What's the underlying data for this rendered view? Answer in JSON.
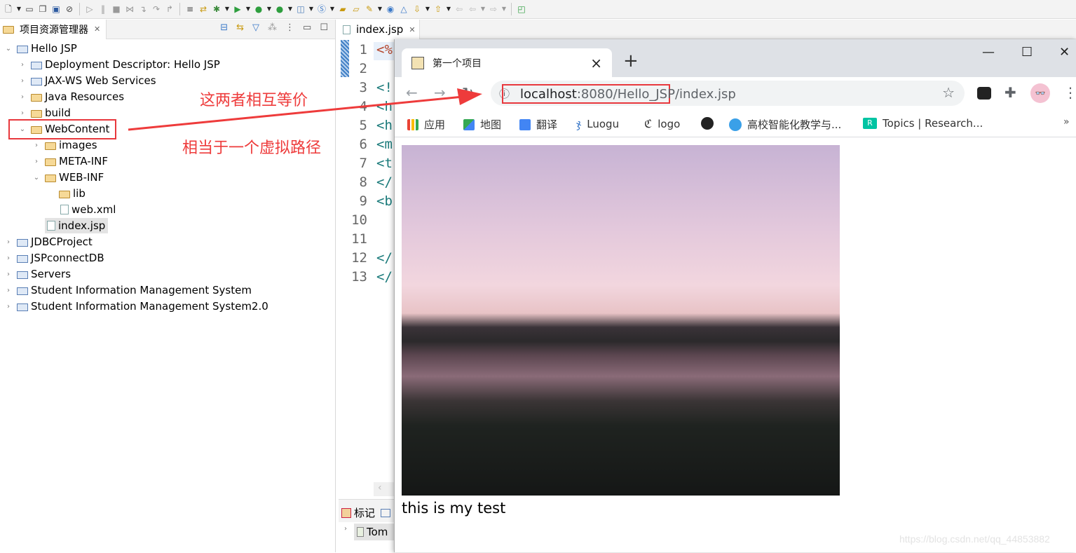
{
  "toolbar": {
    "icons": [
      "new-icon",
      "save-icon",
      "save-all-icon",
      "console-icon",
      "skip-breakpoints-icon",
      "resume-icon",
      "suspend-icon",
      "terminate-icon",
      "disconnect-icon",
      "step-into-icon",
      "step-over-icon",
      "step-return-icon",
      "drop-to-frame-icon",
      "use-step-filters-icon",
      "debug-icon",
      "run-icon",
      "run-config-icon",
      "external-tools-icon",
      "new-server-icon",
      "new-spring-icon",
      "open-type-icon",
      "open-folder-icon",
      "search-icon",
      "web-browser-icon",
      "web-service-icon",
      "next-annotation-icon",
      "prev-annotation-icon",
      "last-edit-icon",
      "back-icon",
      "forward-icon",
      "open-perspective-icon"
    ]
  },
  "explorer": {
    "title": "项目资源管理器",
    "tree": [
      {
        "label": "Hello JSP",
        "depth": 0,
        "expanded": true,
        "icon": "web-project-icon"
      },
      {
        "label": "Deployment Descriptor: Hello JSP",
        "depth": 1,
        "expanded": false,
        "icon": "deployment-descriptor-icon"
      },
      {
        "label": "JAX-WS Web Services",
        "depth": 1,
        "expanded": false,
        "icon": "web-services-icon"
      },
      {
        "label": "Java Resources",
        "depth": 1,
        "expanded": false,
        "icon": "java-resources-icon"
      },
      {
        "label": "build",
        "depth": 1,
        "expanded": false,
        "icon": "folder-icon"
      },
      {
        "label": "WebContent",
        "depth": 1,
        "expanded": true,
        "icon": "folder-icon",
        "highlighted": true
      },
      {
        "label": "images",
        "depth": 2,
        "expanded": false,
        "icon": "folder-icon"
      },
      {
        "label": "META-INF",
        "depth": 2,
        "expanded": false,
        "icon": "folder-icon"
      },
      {
        "label": "WEB-INF",
        "depth": 2,
        "expanded": true,
        "icon": "folder-icon"
      },
      {
        "label": "lib",
        "depth": 3,
        "icon": "folder-icon"
      },
      {
        "label": "web.xml",
        "depth": 3,
        "icon": "xml-file-icon"
      },
      {
        "label": "index.jsp",
        "depth": 2,
        "icon": "jsp-file-icon",
        "selected": true
      },
      {
        "label": "JDBCProject",
        "depth": 0,
        "expanded": false,
        "icon": "project-icon"
      },
      {
        "label": "JSPconnectDB",
        "depth": 0,
        "expanded": false,
        "icon": "web-project-icon"
      },
      {
        "label": "Servers",
        "depth": 0,
        "expanded": false,
        "icon": "project-icon"
      },
      {
        "label": "Student Information Management System",
        "depth": 0,
        "expanded": false,
        "icon": "web-project-icon"
      },
      {
        "label": "Student Information Management System2.0",
        "depth": 0,
        "expanded": false,
        "icon": "web-project-icon"
      }
    ]
  },
  "editor": {
    "tab": "index.jsp",
    "lines": [
      {
        "n": "1",
        "code": "<%"
      },
      {
        "n": "2",
        "code": ""
      },
      {
        "n": "3",
        "code": "<!"
      },
      {
        "n": "4",
        "code": "<h"
      },
      {
        "n": "5",
        "code": "<h"
      },
      {
        "n": "6",
        "code": "<m"
      },
      {
        "n": "7",
        "code": "<t"
      },
      {
        "n": "8",
        "code": "</"
      },
      {
        "n": "9",
        "code": "<b"
      },
      {
        "n": "10",
        "code": ""
      },
      {
        "n": "11",
        "code": ""
      },
      {
        "n": "12",
        "code": "</"
      },
      {
        "n": "13",
        "code": "</"
      }
    ],
    "bottom_tab": "标记",
    "servers_item": "Tom"
  },
  "annotations": {
    "equivalent": "这两者相互等价",
    "virtual_path": "相当于一个虚拟路径",
    "color": "#ee3b3b"
  },
  "browser": {
    "tab_title": "第一个项目",
    "url_host": "localhost",
    "url_rest": ":8080/Hello_JSP/index.jsp",
    "bookmarks": [
      {
        "label": "应用",
        "icon": "apps-grid-icon"
      },
      {
        "label": "地图",
        "icon": "maps-icon"
      },
      {
        "label": "翻译",
        "icon": "translate-icon"
      },
      {
        "label": "Luogu",
        "icon": "luogu-icon"
      },
      {
        "label": "logo",
        "icon": "logo-icon"
      },
      {
        "label": "",
        "icon": "github-icon"
      },
      {
        "label": "高校智能化教学与...",
        "icon": "school-icon"
      },
      {
        "label": "Topics | Research...",
        "icon": "researchgate-icon"
      }
    ],
    "page_text": "this is my test"
  },
  "watermark": "https://blog.csdn.net/qq_44853882"
}
